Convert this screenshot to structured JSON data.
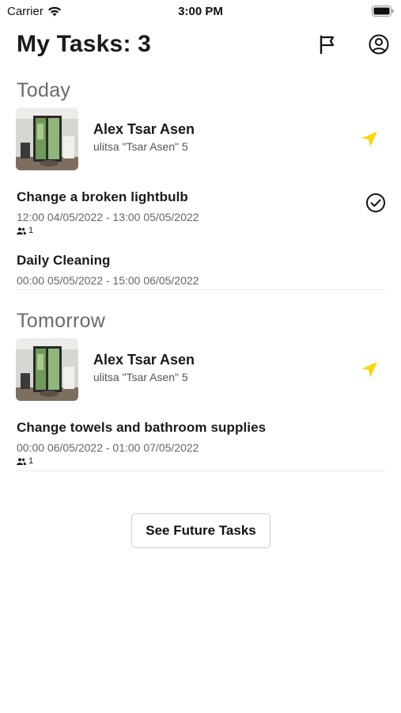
{
  "status_bar": {
    "carrier": "Carrier",
    "time": "3:00 PM"
  },
  "header": {
    "title": "My Tasks: 3",
    "flag_icon": "flag-icon",
    "profile_icon": "user-circle-icon"
  },
  "sections": [
    {
      "title": "Today",
      "property": {
        "name": "Alex Tsar Asen",
        "address": "ulitsa \"Tsar Asen\" 5",
        "nav_icon": "navigation-arrow-icon"
      },
      "tasks": [
        {
          "title": "Change a broken lightbulb",
          "time": "12:00 04/05/2022 - 13:00 05/05/2022",
          "people": "1",
          "completed": true
        },
        {
          "title": "Daily Cleaning",
          "time": "00:00 05/05/2022 - 15:00 06/05/2022",
          "completed": false
        }
      ]
    },
    {
      "title": "Tomorrow",
      "property": {
        "name": "Alex Tsar Asen",
        "address": "ulitsa \"Tsar Asen\" 5",
        "nav_icon": "navigation-arrow-icon"
      },
      "tasks": [
        {
          "title": "Change towels and bathroom supplies",
          "time": "00:00 06/05/2022 - 01:00 07/05/2022",
          "people": "1",
          "completed": false
        }
      ]
    }
  ],
  "future_button": {
    "label": "See Future Tasks"
  },
  "colors": {
    "accent": "#FFD60A",
    "text": "#1a1a1a",
    "section": "#6a6a6a"
  }
}
